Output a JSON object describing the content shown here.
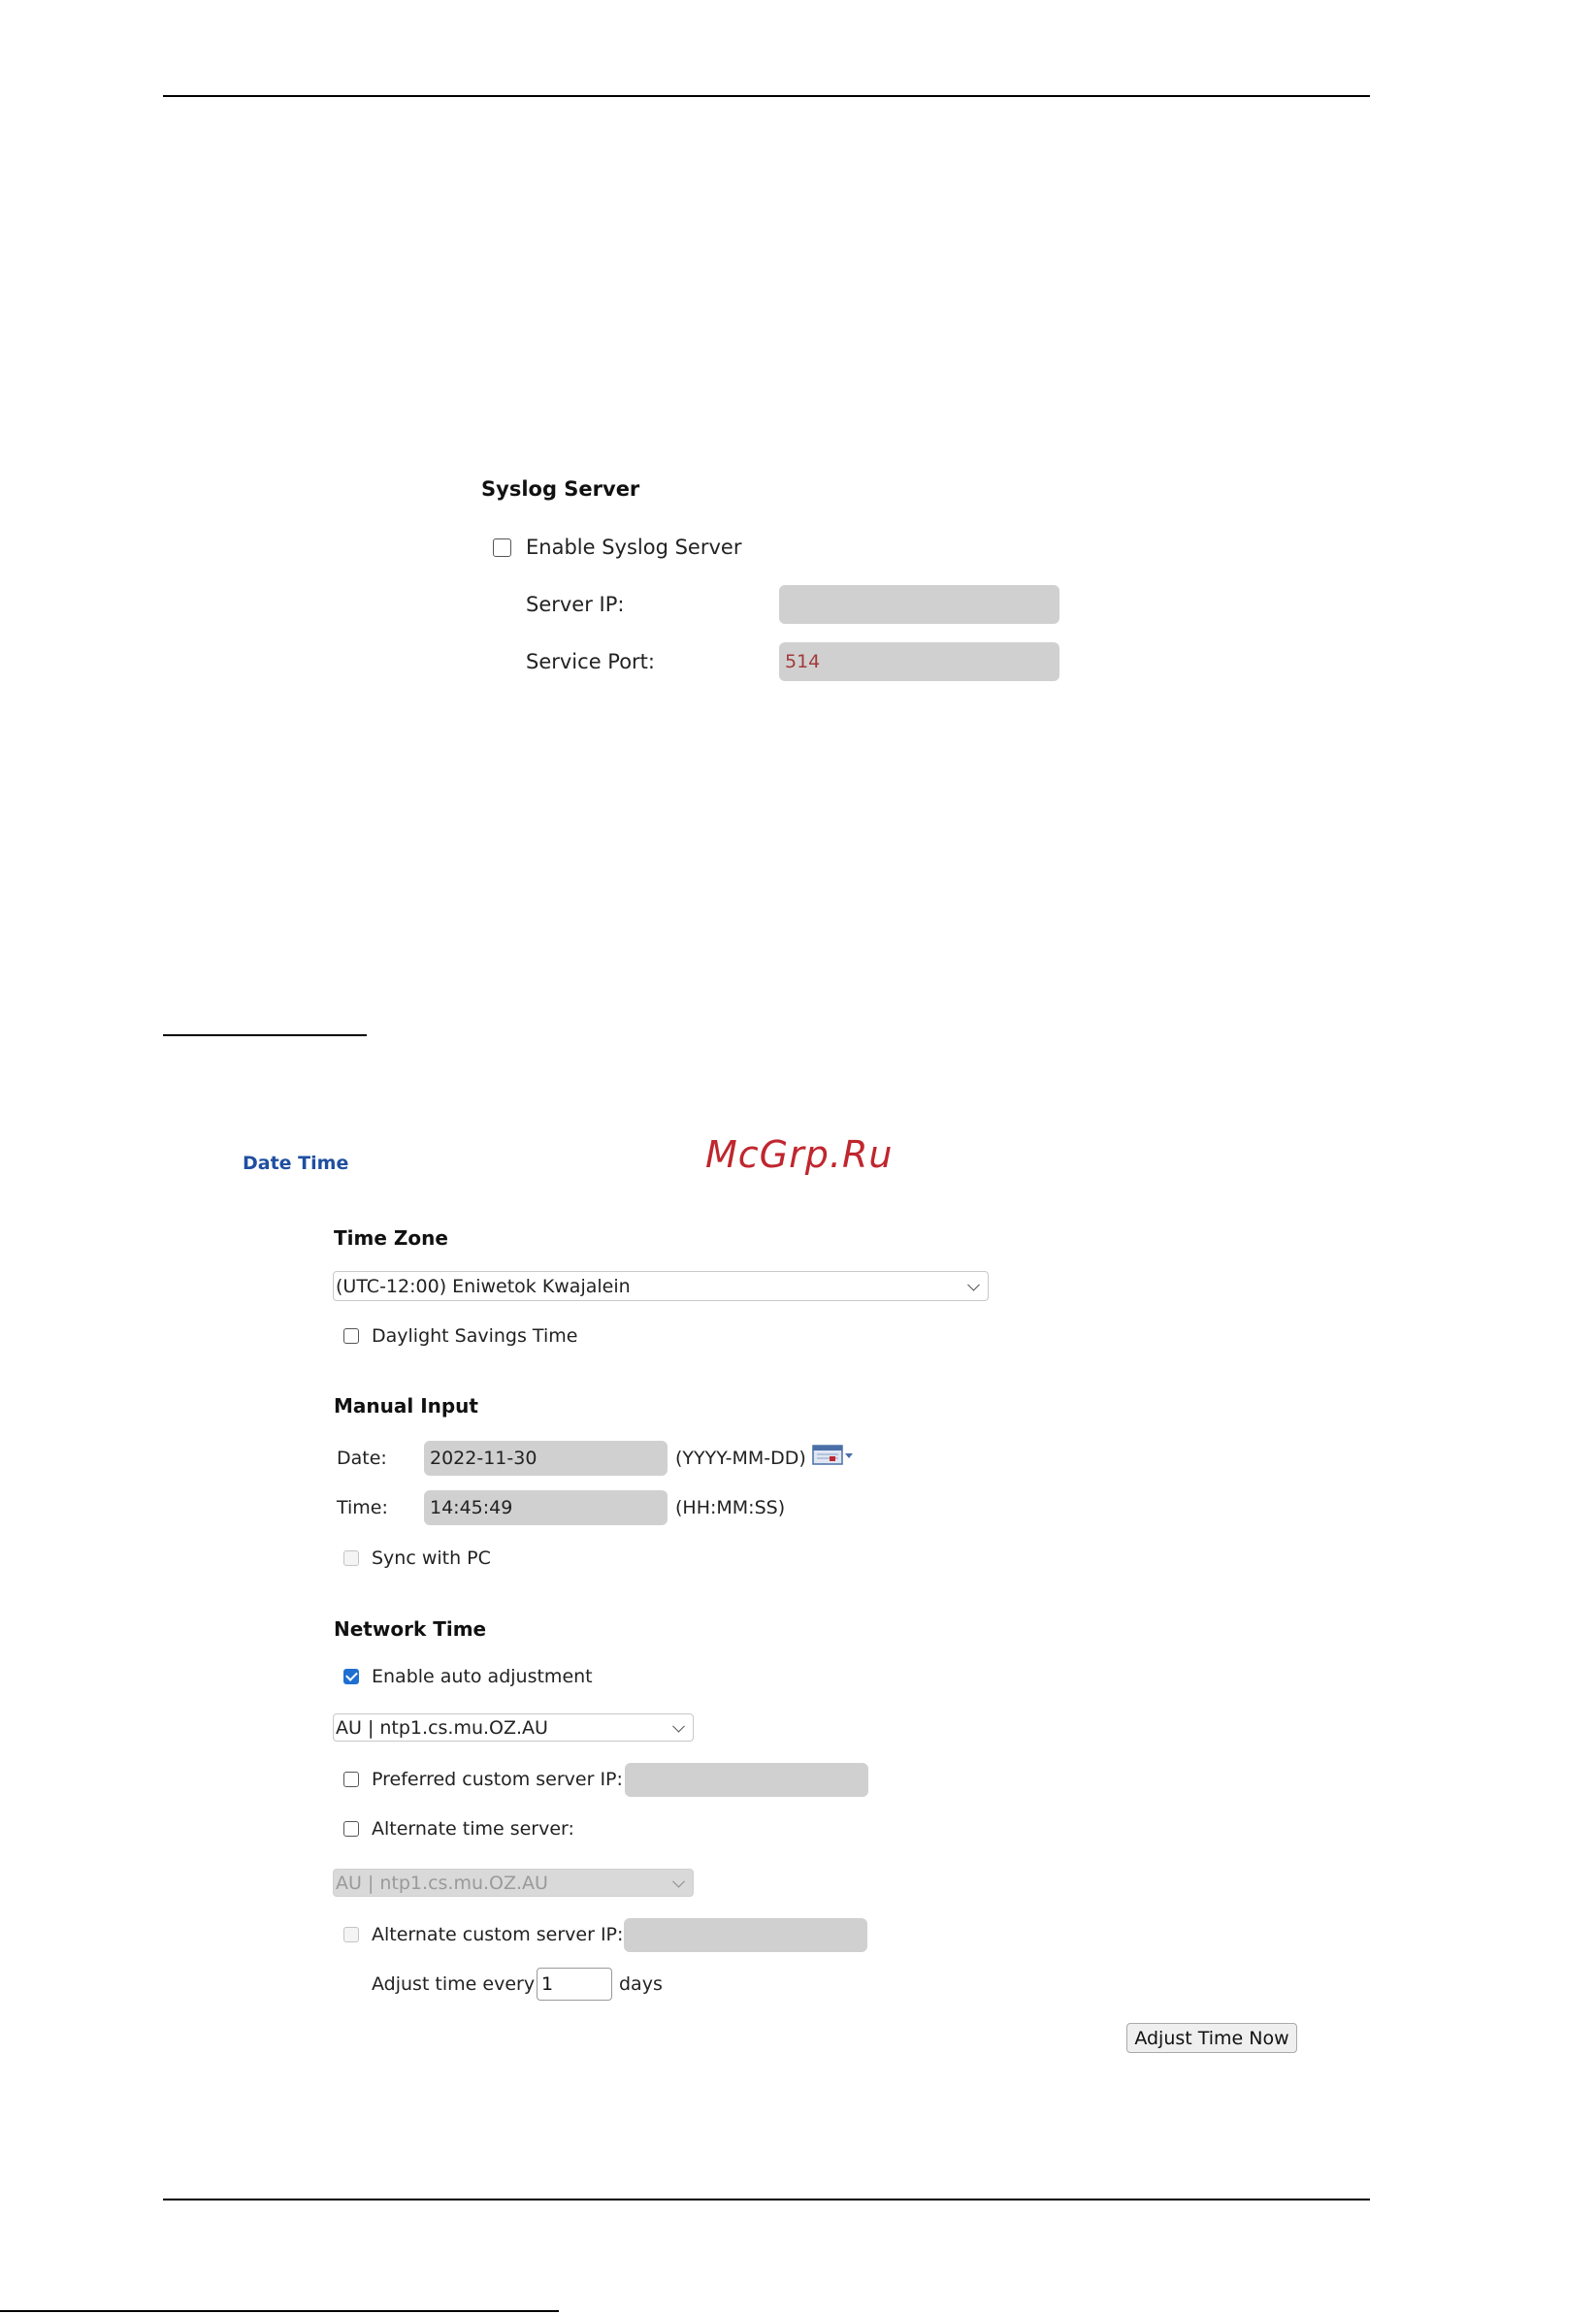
{
  "syslog": {
    "title": "Syslog Server",
    "enable_label": "Enable Syslog Server",
    "enabled": false,
    "server_ip_label": "Server IP:",
    "server_ip_value": "",
    "service_port_label": "Service Port:",
    "service_port_value": "514"
  },
  "date_time": {
    "section_label": "Date Time",
    "watermark": "McGrp.Ru",
    "time_zone": {
      "title": "Time Zone",
      "selected": "(UTC-12:00) Eniwetok Kwajalein",
      "dst_label": "Daylight Savings Time",
      "dst_enabled": false
    },
    "manual_input": {
      "title": "Manual Input",
      "date_label": "Date:",
      "date_value": "2022-11-30",
      "date_format": "(YYYY-MM-DD)",
      "time_label": "Time:",
      "time_value": "14:45:49",
      "time_format": "(HH:MM:SS)",
      "sync_label": "Sync with PC",
      "sync_enabled": false
    },
    "network_time": {
      "title": "Network Time",
      "auto_adjust_label": "Enable auto adjustment",
      "auto_adjust_enabled": true,
      "server_selected": "AU | ntp1.cs.mu.OZ.AU",
      "preferred_custom_label": "Preferred custom server IP:",
      "preferred_custom_value": "",
      "alternate_label": "Alternate time server:",
      "alternate_selected": "AU | ntp1.cs.mu.OZ.AU",
      "alternate_custom_label": "Alternate custom server IP:",
      "alternate_custom_value": "",
      "adjust_every_label": "Adjust time every",
      "adjust_every_value": "1",
      "adjust_every_unit": "days",
      "adjust_now_button": "Adjust Time Now"
    }
  },
  "colors": {
    "section_link": "#1f4fa0",
    "watermark": "#c0262e",
    "port_value": "#a33a3a",
    "checked_accent": "#1f6fd1"
  }
}
